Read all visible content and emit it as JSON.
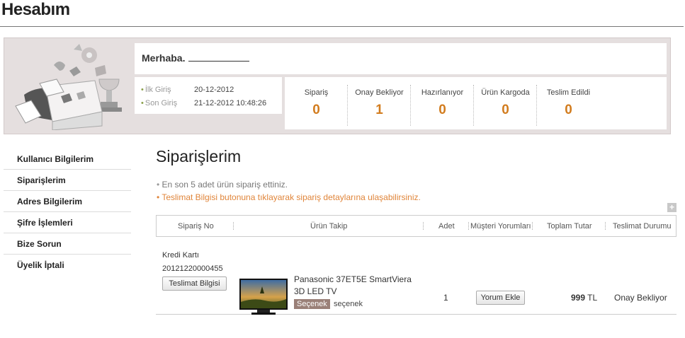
{
  "page": {
    "title": "Hesabım"
  },
  "summary": {
    "greeting": "Merhaba.",
    "login": {
      "first_label": "İlk Giriş",
      "first_value": "20-12-2012",
      "last_label": "Son Giriş",
      "last_value": "21-12-2012 10:48:26"
    },
    "stats": [
      {
        "label": "Sipariş",
        "value": "0"
      },
      {
        "label": "Onay Bekliyor",
        "value": "1"
      },
      {
        "label": "Hazırlanıyor",
        "value": "0"
      },
      {
        "label": "Ürün Kargoda",
        "value": "0"
      },
      {
        "label": "Teslim Edildi",
        "value": "0"
      }
    ]
  },
  "sidebar": {
    "items": [
      {
        "label": "Kullanıcı Bilgilerim"
      },
      {
        "label": "Siparişlerim"
      },
      {
        "label": "Adres Bilgilerim"
      },
      {
        "label": "Şifre İşlemleri"
      },
      {
        "label": "Bize Sorun"
      },
      {
        "label": "Üyelik İptali"
      }
    ]
  },
  "orders": {
    "title": "Siparişlerim",
    "info_1": "En son 5 adet ürün sipariş ettiniz.",
    "info_2": "Teslimat Bilgisi butonuna tıklayarak sipariş detaylarına ulaşabilirsiniz.",
    "expand_label": "+",
    "columns": {
      "order_no": "Sipariş No",
      "tracking": "Ürün Takip",
      "qty": "Adet",
      "reviews": "Müşteri Yorumları",
      "total": "Toplam Tutar",
      "status": "Teslimat Durumu"
    },
    "rows": [
      {
        "payment": "Kredi Kartı",
        "order_no": "20121220000455",
        "delivery_button": "Teslimat Bilgisi",
        "product_name": "Panasonic 37ET5E SmartViera 3D LED TV",
        "badge": "Seçenek",
        "option": "seçenek",
        "qty": "1",
        "review_button": "Yorum Ekle",
        "total_amount": "999",
        "currency": "TL",
        "status": "Onay Bekliyor"
      }
    ]
  },
  "colors": {
    "accent": "#d27c1e",
    "panel_bg": "#e5dfdf",
    "badge_bg": "#9a8078"
  }
}
